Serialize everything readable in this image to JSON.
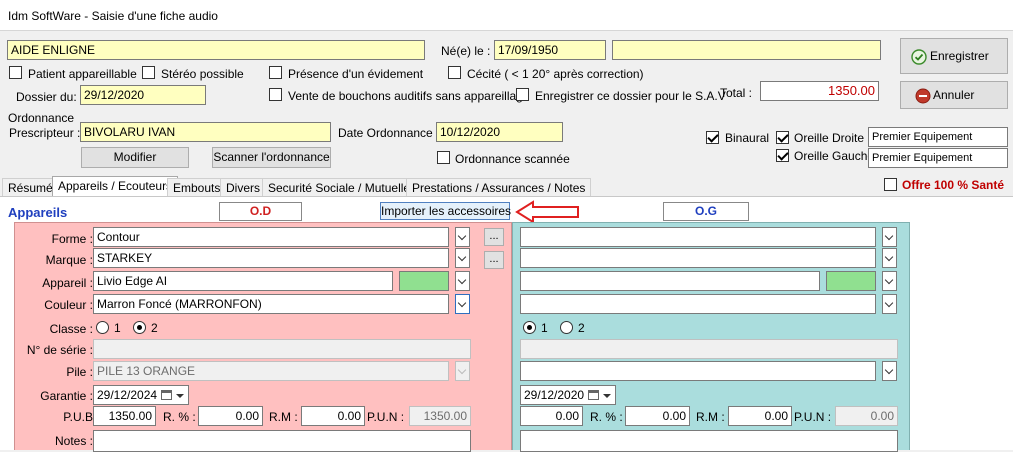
{
  "window": {
    "title": "Idm SoftWare - Saisie d'une fiche audio"
  },
  "patient": {
    "name": "AIDE ENLIGNE",
    "dob_label": "Né(e) le :",
    "dob": "17/09/1950",
    "extra": "",
    "total_label": "Total :",
    "total": "1350.00",
    "total_color": "#c00000"
  },
  "checkboxes": {
    "patient_appareille": {
      "label": "Patient appareillable",
      "checked": false
    },
    "stereo": {
      "label": "Stéréo possible",
      "checked": false
    },
    "evidement": {
      "label": "Présence d'un évidement",
      "checked": false
    },
    "cecite": {
      "label": "Cécité ( < 1 20° après correction)",
      "checked": false
    },
    "bouchons": {
      "label": "Vente de bouchons auditifs sans appareillage",
      "checked": false
    },
    "sav": {
      "label": "Enregistrer ce dossier pour le S.A.V",
      "checked": false
    },
    "ordonnance_scannee": {
      "label": "Ordonnance scannée",
      "checked": false
    },
    "binaural": {
      "label": "Binaural",
      "checked": true
    },
    "oreille_droite": {
      "label": "Oreille Droite",
      "checked": true
    },
    "oreille_gauche": {
      "label": "Oreille Gauche",
      "checked": true
    },
    "offre": {
      "label": "Offre 100 % Santé",
      "checked": false
    }
  },
  "dossier": {
    "label": "Dossier du:",
    "value": "29/12/2020"
  },
  "ordonnance": {
    "label1": "Ordonnance",
    "label2": "Prescripteur :",
    "prescripteur": "BIVOLARU IVAN",
    "date_label": "Date Ordonnance :",
    "date": "10/12/2020",
    "modifier": "Modifier",
    "scanner": "Scanner l'ordonnance"
  },
  "equipement": {
    "droite": "Premier Equipement",
    "gauche": "Premier Equipement"
  },
  "buttons": {
    "enregistrer": "Enregistrer",
    "annuler": "Annuler",
    "importer": "Importer les accessoires"
  },
  "tabs": [
    {
      "label": "Résumé"
    },
    {
      "label": "Appareils / Ecouteurs"
    },
    {
      "label": "Embouts"
    },
    {
      "label": "Divers"
    },
    {
      "label": "Securité Sociale / Mutuelles"
    },
    {
      "label": "Prestations / Assurances / Notes"
    }
  ],
  "section": {
    "title": "Appareils",
    "od": "O.D",
    "og": "O.G"
  },
  "labels": {
    "forme": "Forme :",
    "marque": "Marque :",
    "appareil": "Appareil :",
    "couleur": "Couleur :",
    "classe": "Classe :",
    "serie": "N° de série :",
    "pile": "Pile :",
    "garantie": "Garantie :",
    "pub": "P.U.B",
    "r": "R. % :",
    "rm": "R.M :",
    "pun": "P.U.N :",
    "notes": "Notes :",
    "one": "1",
    "two": "2",
    "dots": "..."
  },
  "od": {
    "forme": "Contour",
    "marque": "STARKEY",
    "appareil": "Livio Edge AI",
    "couleur": "Marron Foncé (MARRONFON)",
    "classe": "2",
    "serie": "",
    "pile": "PILE 13 ORANGE",
    "garantie": "29/12/2024",
    "pub": "1350.00",
    "r": "0.00",
    "rm": "0.00",
    "pun": "1350.00",
    "swatch_color": "#90e090"
  },
  "og": {
    "forme": "",
    "marque": "",
    "appareil": "",
    "couleur": "",
    "classe": "1",
    "serie": "",
    "pile": "",
    "garantie": "29/12/2020",
    "pub": "0.00",
    "r": "0.00",
    "rm": "0.00",
    "pun": "0.00",
    "swatch_color": "#90e090"
  }
}
